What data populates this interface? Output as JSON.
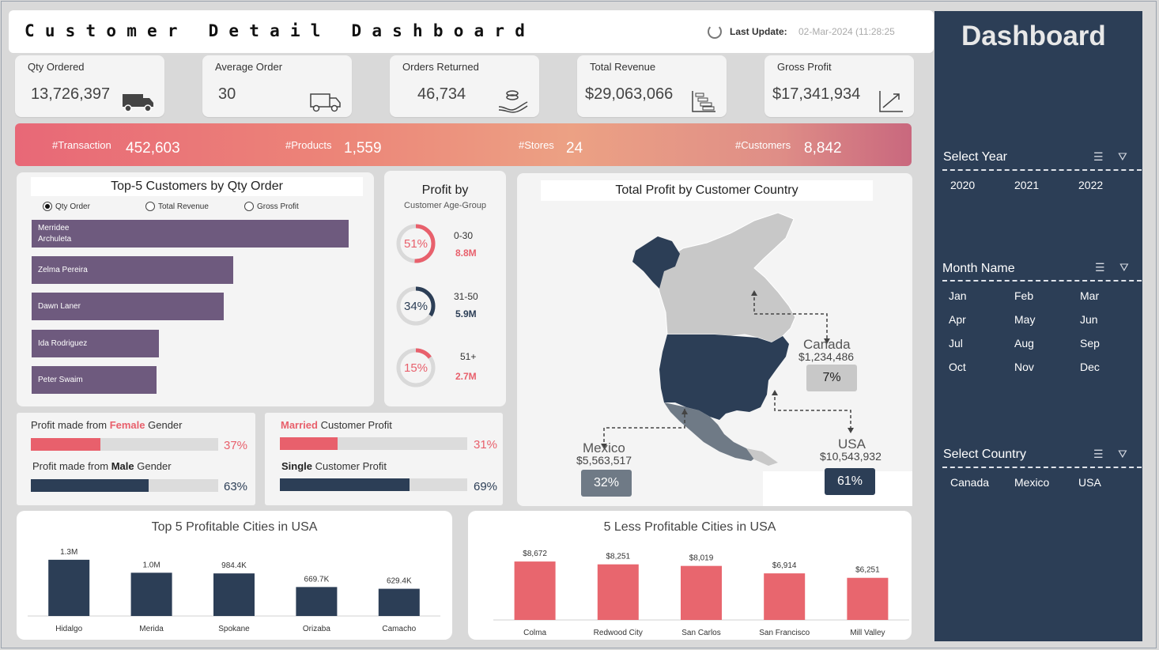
{
  "header": {
    "title": "Customer Detail Dashboard",
    "last_update_label": "Last Update:",
    "last_update_value": "02-Mar-2024 (11:28:25"
  },
  "kpis": [
    {
      "label": "Qty Ordered",
      "value": "13,726,397",
      "icon": "truck-icon"
    },
    {
      "label": "Average Order",
      "value": "30",
      "icon": "delivery-van-icon"
    },
    {
      "label": "Orders Returned",
      "value": "46,734",
      "icon": "hand-coins-icon"
    },
    {
      "label": "Total Revenue",
      "value": "$29,063,066",
      "icon": "bar-chart-icon"
    },
    {
      "label": "Gross Profit",
      "value": "$17,341,934",
      "icon": "trend-up-icon"
    }
  ],
  "band": {
    "transaction_label": "#Transaction",
    "transaction_value": "452,603",
    "products_label": "#Products",
    "products_value": "1,559",
    "stores_label": "#Stores",
    "stores_value": "24",
    "customers_label": "#Customers",
    "customers_value": "8,842"
  },
  "top_customers": {
    "title": "Top-5 Customers by Qty Order",
    "options": [
      "Qty Order",
      "Total Revenue",
      "Gross Profit"
    ],
    "selected": "Qty Order",
    "names": [
      "Merridee",
      "Archuleta",
      "Zelma Pereira",
      "Dawn Laner",
      "Ida Rodriguez",
      "Peter Swaim"
    ],
    "shares": [
      1.0,
      0.635,
      0.605,
      0.402,
      0.395
    ],
    "color": "#6e5a7e"
  },
  "profit_by_age": {
    "title": "Profit by",
    "subtitle": "Customer Age-Group",
    "groups": [
      {
        "group": "0-30",
        "pct": "51%",
        "value": "8.8M",
        "fraction": 0.51,
        "color": "#e8606c"
      },
      {
        "group": "31-50",
        "pct": "34%",
        "value": "5.9M",
        "fraction": 0.34,
        "color": "#2c3e56"
      },
      {
        "group": "51+",
        "pct": "15%",
        "value": "2.7M",
        "fraction": 0.15,
        "color": "#e8606c"
      }
    ]
  },
  "map": {
    "title": "Total Profit by Customer Country",
    "countries": [
      {
        "name": "Canada",
        "value": "$1,234,486",
        "pct": "7%"
      },
      {
        "name": "Mexico",
        "value": "$5,563,517",
        "pct": "32%"
      },
      {
        "name": "USA",
        "value": "$10,543,932",
        "pct": "61%"
      }
    ]
  },
  "gender": {
    "female_prefix": "Profit made from ",
    "female_word": "Female",
    "female_suffix": " Gender",
    "female_pct": "37%",
    "female_fraction": 0.37,
    "male_prefix": "Profit made from ",
    "male_word": "Male",
    "male_suffix": " Gender",
    "male_pct": "63%",
    "male_fraction": 0.63
  },
  "marital": {
    "married_word": "Married",
    "married_suffix": " Customer Profit",
    "married_pct": "31%",
    "married_fraction": 0.31,
    "single_word": "Single",
    "single_suffix": " Customer Profit",
    "single_pct": "69%",
    "single_fraction": 0.69
  },
  "chart_data": [
    {
      "type": "bar",
      "title": "Top 5 Profitable Cities in USA",
      "categories": [
        "Hidalgo",
        "Merida",
        "Spokane",
        "Orizaba",
        "Camacho"
      ],
      "values": [
        1300000,
        1000000,
        984400,
        669700,
        629400
      ],
      "labels": [
        "1.3M",
        "1.0M",
        "984.4K",
        "669.7K",
        "629.4K"
      ],
      "ylim": [
        0,
        1700000
      ],
      "color": "#2c3e56"
    },
    {
      "type": "bar",
      "title": "5 Less Profitable Cities in USA",
      "categories": [
        "Colma",
        "Redwood City",
        "San Carlos",
        "San Francisco",
        "Mill Valley"
      ],
      "values": [
        8672,
        8251,
        8019,
        6914,
        6251
      ],
      "labels": [
        "$8,672",
        "$8,251",
        "$8,019",
        "$6,914",
        "$6,251"
      ],
      "ylim": [
        0,
        11500
      ],
      "color": "#e8666e"
    }
  ],
  "side": {
    "title": "Dashboard",
    "year_label": "Select Year",
    "years": [
      "2020",
      "2021",
      "2022"
    ],
    "month_label": "Month Name",
    "months": [
      "Jan",
      "Feb",
      "Mar",
      "Apr",
      "May",
      "Jun",
      "Jul",
      "Aug",
      "Sep",
      "Oct",
      "Nov",
      "Dec"
    ],
    "country_label": "Select Country",
    "countries": [
      "Canada",
      "Mexico",
      "USA"
    ]
  }
}
